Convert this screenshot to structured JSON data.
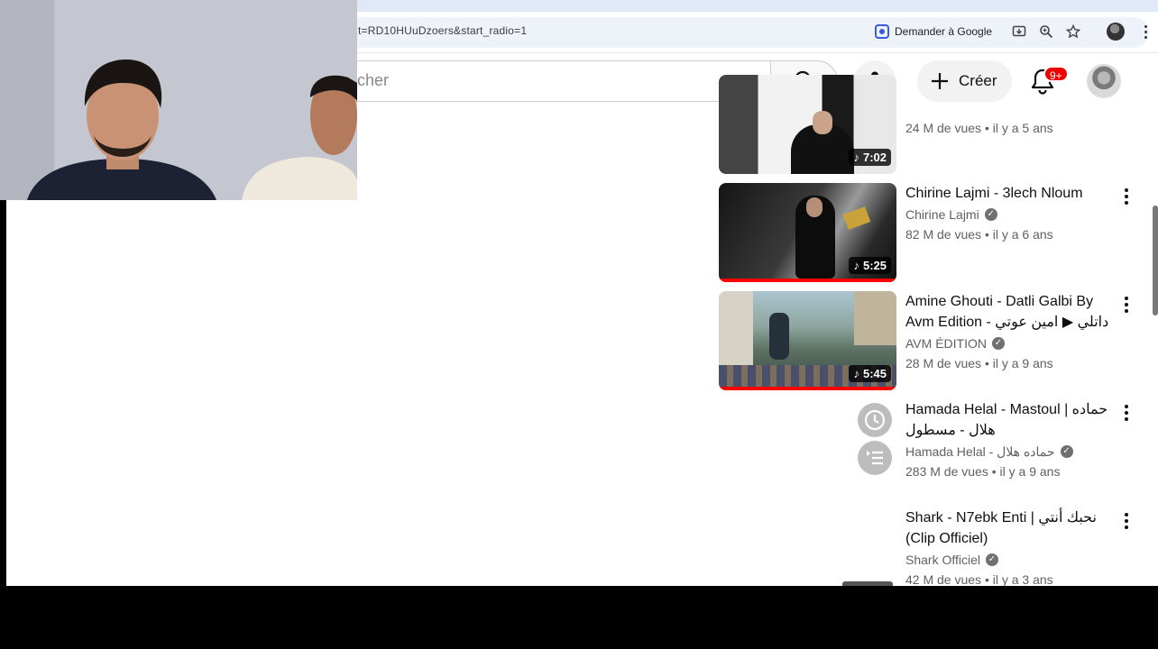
{
  "browser": {
    "url": "t=RD10HUuDzoers&start_radio=1",
    "ask_google_label": "Demander à Google"
  },
  "header": {
    "search_placeholder": "cher",
    "create_label": "Créer",
    "notifications_badge": "9+"
  },
  "related": [
    {
      "title": "",
      "channel": "",
      "stats": "24 M de vues • il y a 5 ans",
      "duration": "7:02",
      "verified": false
    },
    {
      "title": "Chirine Lajmi - 3lech Nloum",
      "channel": "Chirine Lajmi",
      "stats": "82 M de vues • il y a 6 ans",
      "duration": "5:25",
      "verified": true
    },
    {
      "title": "Amine Ghouti - Datli Galbi By Avm Edition - داتلي ▶ امين عوتي ...",
      "channel": "AVM ÉDITION",
      "stats": "28 M de vues • il y a 9 ans",
      "duration": "5:45",
      "verified": true
    },
    {
      "title": "Hamada Helal - Mastoul | حماده هلال - مسطول",
      "channel": "Hamada Helal - حماده هلال",
      "stats": "283 M de vues • il y a 9 ans",
      "duration": "",
      "verified": true
    },
    {
      "title": "Shark - N7ebk Enti | نحبك أنتي (Clip Officiel)",
      "channel": "Shark Officiel",
      "stats": "42 M de vues • il y a 3 ans",
      "duration": "",
      "verified": true
    }
  ],
  "icons": {
    "search": "search-icon",
    "mic": "mic-icon",
    "plus": "plus-icon",
    "bell": "bell-icon",
    "clock": "watch-later-icon",
    "queue": "add-to-queue-icon"
  },
  "colors": {
    "progress": "#ff0000",
    "badge": "#ee0000",
    "accent_google": "#3a5ad9"
  }
}
